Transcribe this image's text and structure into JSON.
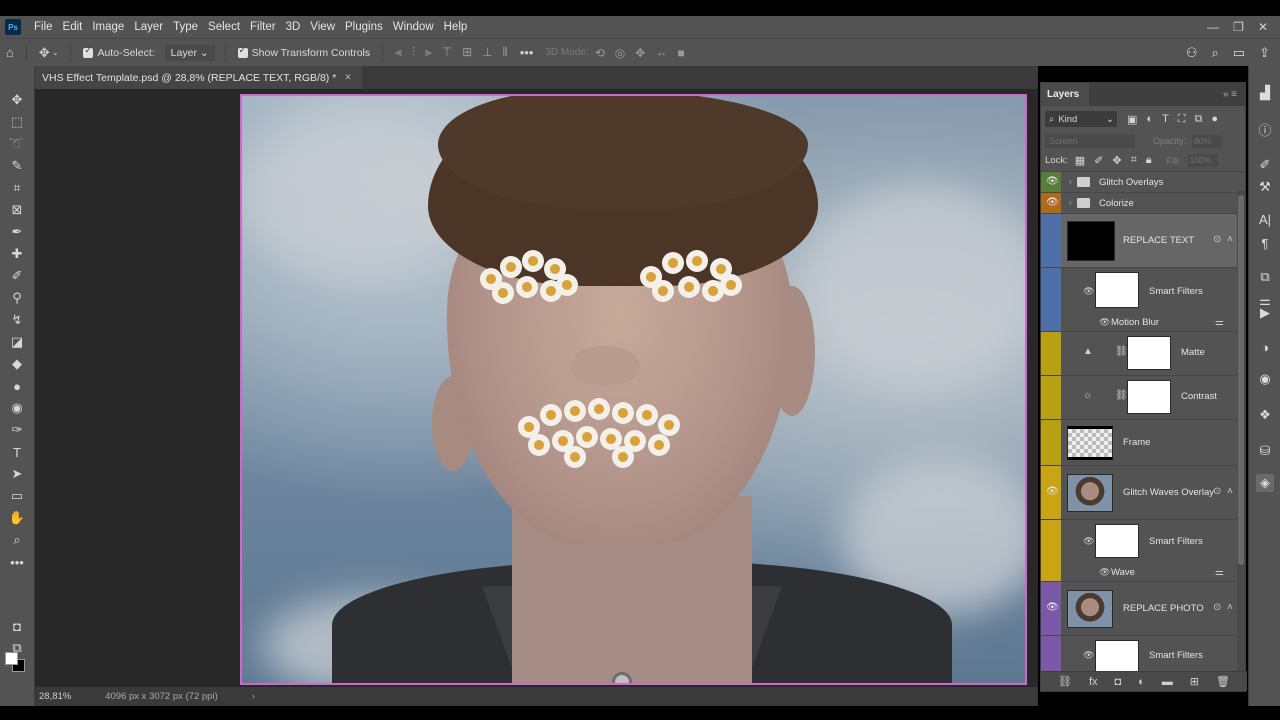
{
  "app": {
    "logo": "Ps"
  },
  "menu": [
    "File",
    "Edit",
    "Image",
    "Layer",
    "Type",
    "Select",
    "Filter",
    "3D",
    "View",
    "Plugins",
    "Window",
    "Help"
  ],
  "options_bar": {
    "auto_select_label": "Auto-Select:",
    "layer_select": "Layer",
    "show_transform_label": "Show Transform Controls",
    "mode_3d_label": "3D Mode:"
  },
  "document": {
    "tab_title": "VHS Effect Template.psd @ 28,8% (REPLACE TEXT, RGB/8) *",
    "zoom": "28,81%",
    "dimensions": "4096 px x 3072 px (72 ppi)"
  },
  "layers_panel": {
    "tab_label": "Layers",
    "kind_label": "Kind",
    "blend_mode": "Screen",
    "opacity_label": "Opacity:",
    "opacity_value": "80%",
    "lock_label": "Lock:",
    "fill_label": "Fill:",
    "fill_value": "100%",
    "layers": {
      "glitch_overlays": {
        "name": "Glitch Overlays",
        "color": "#5a7d3a"
      },
      "colorize": {
        "name": "Colorize",
        "color": "#b06a1e"
      },
      "replace_text": {
        "name": "REPLACE TEXT",
        "color": "#4f6fa8"
      },
      "replace_text_smart_filters": "Smart Filters",
      "replace_text_filter": "Motion Blur",
      "matte": {
        "name": "Matte",
        "color": "#b8a012"
      },
      "contrast": {
        "name": "Contrast",
        "color": "#b8a012"
      },
      "frame": {
        "name": "Frame",
        "color": "#b8a012"
      },
      "glitch_waves": {
        "name": "Glitch Waves Overlay",
        "color": "#c9a514"
      },
      "glitch_waves_smart_filters": "Smart Filters",
      "glitch_waves_filter": "Wave",
      "replace_photo": {
        "name": "REPLACE PHOTO",
        "color": "#7a5aa8"
      },
      "replace_photo_smart_filters": "Smart Filters"
    }
  },
  "colors": {
    "canvas_border": "#cf67d0",
    "ui_bg": "#535353",
    "panel_bg": "#3f3f3f"
  }
}
